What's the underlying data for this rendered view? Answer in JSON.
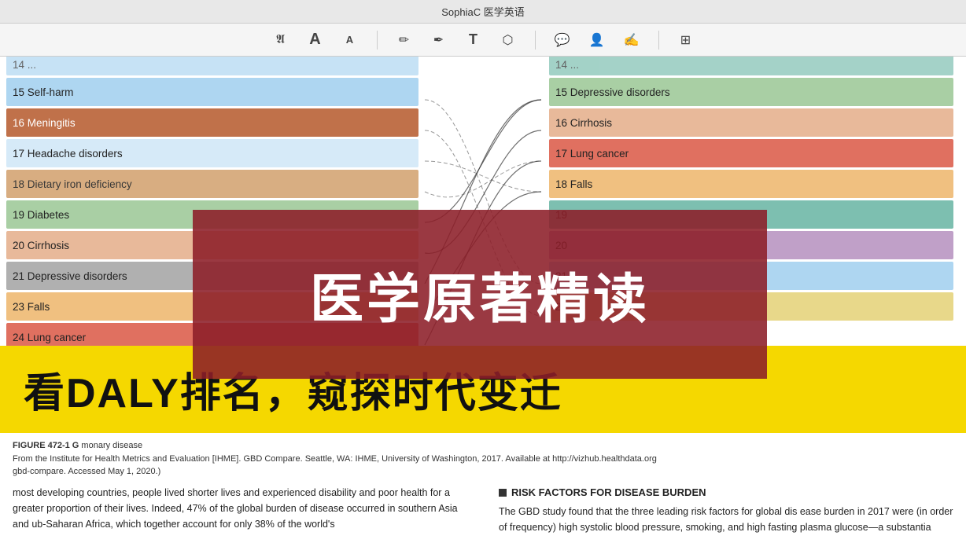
{
  "app": {
    "title": "SophiaC 医学英语"
  },
  "toolbar": {
    "icons": [
      {
        "name": "text-format-icon",
        "symbol": "𝖠"
      },
      {
        "name": "text-size-large-icon",
        "symbol": "A"
      },
      {
        "name": "text-size-small-icon",
        "symbol": "A"
      },
      {
        "name": "separator1",
        "type": "separator"
      },
      {
        "name": "pencil-icon",
        "symbol": "✏"
      },
      {
        "name": "pen-icon",
        "symbol": "✒"
      },
      {
        "name": "text-icon",
        "symbol": "T"
      },
      {
        "name": "shape-icon",
        "symbol": "⬡"
      },
      {
        "name": "separator2",
        "type": "separator"
      },
      {
        "name": "comment-icon",
        "symbol": "💬"
      },
      {
        "name": "user-icon",
        "symbol": "👤"
      },
      {
        "name": "signature-icon",
        "symbol": "✍"
      },
      {
        "name": "separator3",
        "type": "separator"
      },
      {
        "name": "select-icon",
        "symbol": "⊞"
      }
    ]
  },
  "chart": {
    "left_rows": [
      {
        "number": "15",
        "label": "Self-harm",
        "color": "row-blue-light"
      },
      {
        "number": "16",
        "label": "Meningitis",
        "color": "row-brown"
      },
      {
        "number": "17",
        "label": "Headache disorders",
        "color": "row-blue-lighter"
      },
      {
        "number": "18",
        "label": "Dietary iron deficiency",
        "color": "row-tan"
      },
      {
        "number": "19",
        "label": "Diabetes",
        "color": "row-green-light"
      },
      {
        "number": "20",
        "label": "Cirrhosis",
        "color": "row-peach"
      },
      {
        "number": "21",
        "label": "Depressive disorders",
        "color": "row-gray"
      },
      {
        "number": "23",
        "label": "Falls",
        "color": "row-orange-light"
      },
      {
        "number": "24",
        "label": "Lung cancer",
        "color": "row-red-light"
      }
    ],
    "right_rows": [
      {
        "number": "15",
        "label": "Depressive disorders",
        "color": "row-green-light"
      },
      {
        "number": "16",
        "label": "Cirrhosis",
        "color": "row-peach"
      },
      {
        "number": "17",
        "label": "Lung cancer",
        "color": "row-red-light"
      },
      {
        "number": "18",
        "label": "Falls",
        "color": "row-orange-light"
      },
      {
        "number": "19",
        "label": "",
        "color": "row-teal"
      },
      {
        "number": "",
        "label": "",
        "color": "row-purple-light"
      },
      {
        "number": "",
        "label": "",
        "color": "row-yellow-light"
      }
    ]
  },
  "red_overlay": {
    "text": "医学原著精读"
  },
  "yellow_banner": {
    "text": "看DALY排名，窥探时代变迁"
  },
  "figure_caption": {
    "bold_part": "FIGURE 472-1 G",
    "text1": "                                                                                                                                              monary disease",
    "text2": "From the Institute for Health Metrics and Evaluation [IHME]. GBD Compare. Seattle, WA: IHME, University of Washington, 2017. Available at http://vizhub.healthdata.org",
    "text3": "gbd-compare. Accessed May 1, 2020.)"
  },
  "body_left": {
    "text": "most developing countries, people lived shorter lives and experienced disability and poor health for a greater proportion of their lives. Indeed, 47% of the global burden of disease occurred in southern Asia and ub-Saharan Africa, which together account for only 38% of the world's"
  },
  "body_right": {
    "section_header": "RISK FACTORS FOR DISEASE BURDEN",
    "text": "The GBD study found that the three leading risk factors for global dis ease burden in 2017 were (in order of frequency) high systolic blood pressure, smoking, and high fasting plasma glucose—a substantia"
  }
}
